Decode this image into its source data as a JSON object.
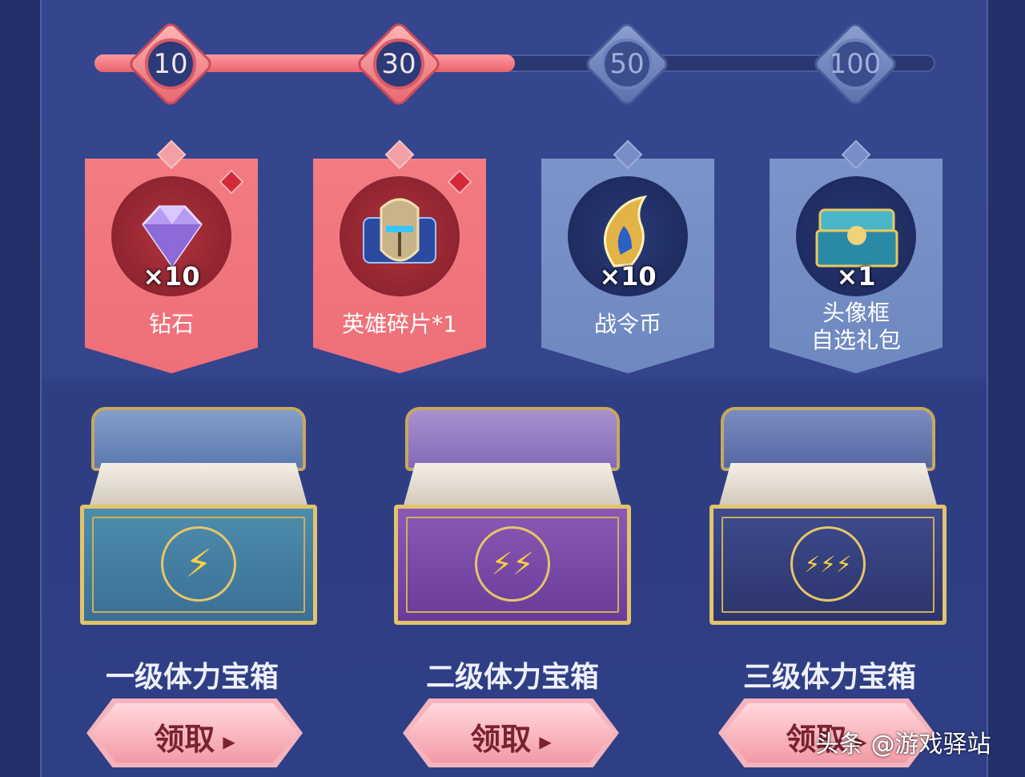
{
  "progress": {
    "nodes": [
      {
        "value": "10",
        "reached": true
      },
      {
        "value": "30",
        "reached": true
      },
      {
        "value": "50",
        "reached": false
      },
      {
        "value": "100",
        "reached": false
      }
    ],
    "fill_fraction": 0.5
  },
  "rewards": [
    {
      "name": "钻石",
      "qty": "×10",
      "icon": "diamond-gem-icon",
      "claimed_badge": true,
      "theme": "red"
    },
    {
      "name": "英雄碎片*1",
      "qty": "",
      "icon": "hero-helmet-fragment-icon",
      "claimed_badge": true,
      "theme": "red"
    },
    {
      "name": "战令币",
      "qty": "×10",
      "icon": "battle-pass-coin-icon",
      "claimed_badge": false,
      "theme": "blue"
    },
    {
      "name": "头像框\n自选礼包",
      "line1": "头像框",
      "line2": "自选礼包",
      "qty": "×1",
      "icon": "avatar-frame-chest-icon",
      "claimed_badge": false,
      "theme": "blue"
    }
  ],
  "chests": [
    {
      "title": "一级体力宝箱",
      "bolts": "⚡",
      "button": "领取"
    },
    {
      "title": "二级体力宝箱",
      "bolts": "⚡⚡",
      "button": "领取"
    },
    {
      "title": "三级体力宝箱",
      "bolts": "⚡⚡⚡",
      "button": "领取"
    }
  ],
  "watermark": "头条 @游戏驿站"
}
